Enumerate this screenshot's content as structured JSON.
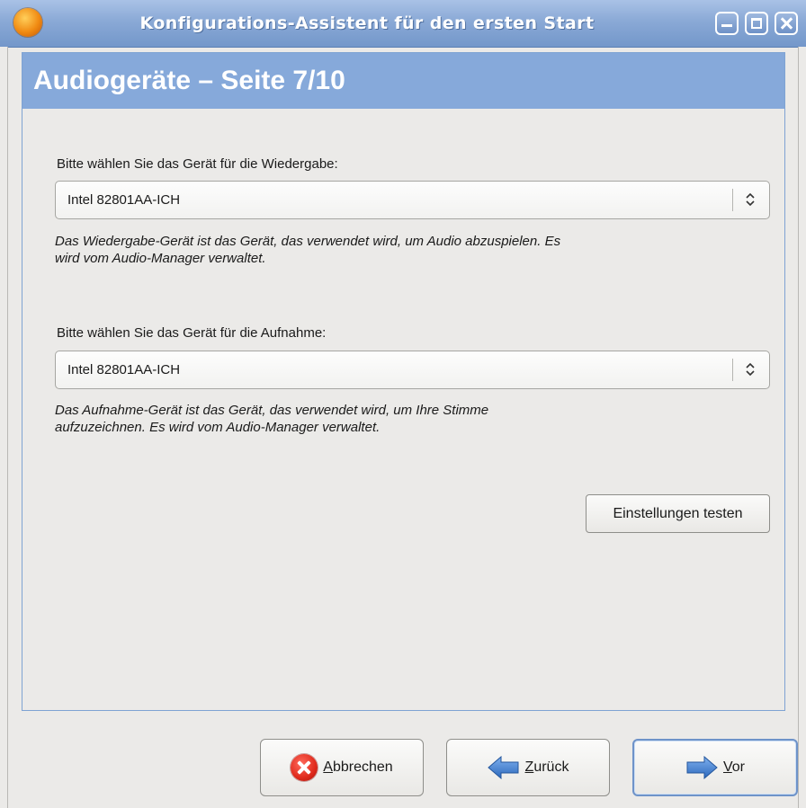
{
  "window": {
    "title": "Konfigurations-Assistent für den ersten Start",
    "controls": [
      "minimize",
      "maximize",
      "close"
    ]
  },
  "page": {
    "title": "Audiogeräte – Seite 7/10"
  },
  "playback": {
    "label": "Bitte wählen Sie das Gerät für die Wiedergabe:",
    "selected": "Intel 82801AA-ICH",
    "help": "Das Wiedergabe-Gerät ist das Gerät, das verwendet wird, um Audio abzuspielen. Es wird vom Audio-Manager verwaltet."
  },
  "recording": {
    "label": "Bitte wählen Sie das Gerät für die Aufnahme:",
    "selected": "Intel 82801AA-ICH",
    "help": "Das Aufnahme-Gerät ist das Gerät, das verwendet wird, um Ihre Stimme aufzuzeichnen. Es wird vom Audio-Manager verwaltet."
  },
  "test_button": {
    "label": "Einstellungen testen"
  },
  "buttons": {
    "cancel": {
      "mnemonic": "A",
      "rest": "bbrechen",
      "icon": "cancel-x-icon"
    },
    "back": {
      "mnemonic": "Z",
      "rest": "urück",
      "icon": "arrow-left-icon"
    },
    "next": {
      "mnemonic": "V",
      "rest": "or",
      "icon": "arrow-right-icon"
    }
  },
  "colors": {
    "titlebar": "#7f9fd0",
    "header": "#86a9da",
    "background": "#ebeae8",
    "arrow": "#3f7fd2"
  }
}
